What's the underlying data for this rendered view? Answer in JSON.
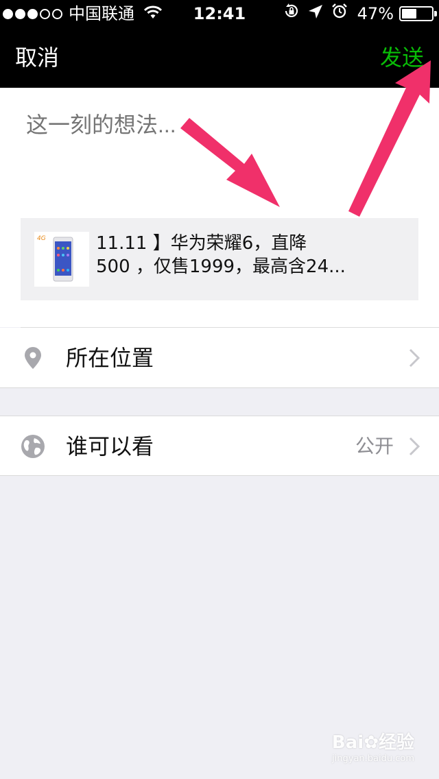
{
  "status_bar": {
    "carrier": "中国联通",
    "time": "12:41",
    "battery_percent": "47%",
    "signal_dots_filled": 3,
    "signal_dots_total": 5
  },
  "nav": {
    "cancel_label": "取消",
    "send_label": "发送",
    "send_color": "#09bb07"
  },
  "compose": {
    "placeholder": "这一刻的想法..."
  },
  "link_card": {
    "line1": "11.11 】华为荣耀6，直降",
    "line2": "500 ，仅售1999，最高含24..."
  },
  "rows": {
    "location_label": "所在位置",
    "visibility_label": "谁可以看",
    "visibility_value": "公开"
  },
  "icons": {
    "location": "location-pin-icon",
    "visibility": "globe-icon",
    "chevron": "chevron-right-icon"
  },
  "annotation_color": "#f0306a",
  "watermark": {
    "brand": "Bai",
    "brand2": "经验",
    "sub": "jingyan.baidu.com"
  }
}
